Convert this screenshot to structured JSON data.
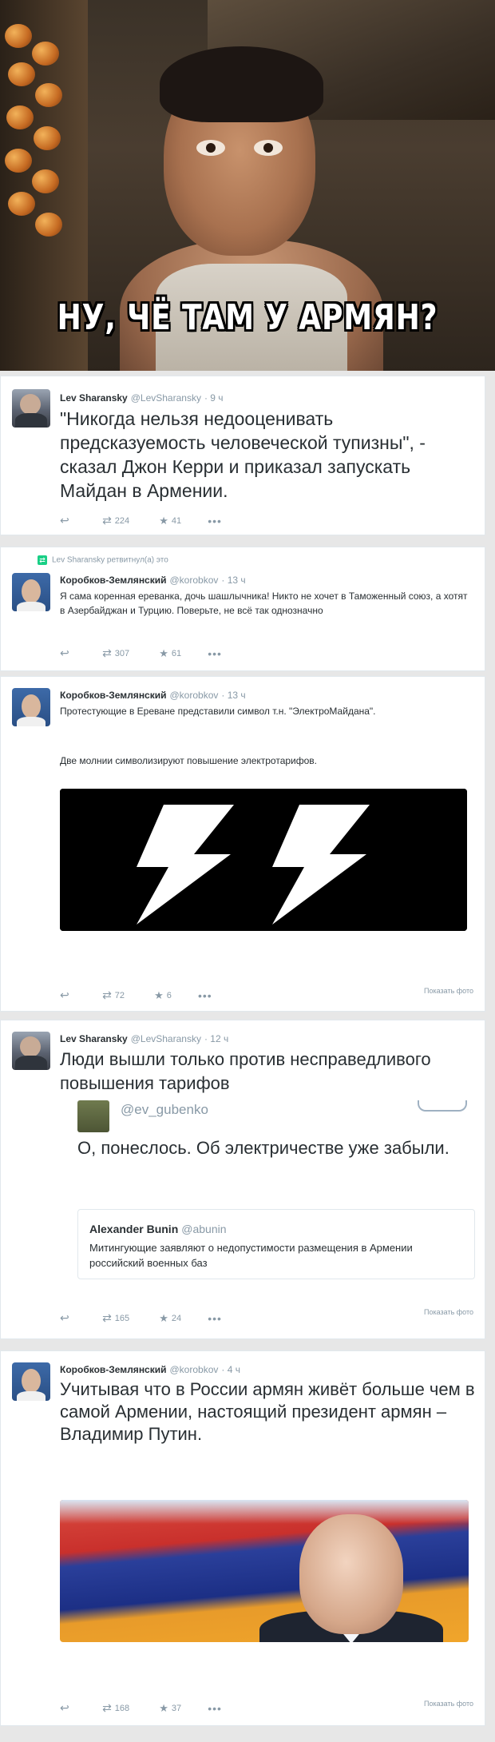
{
  "meme": {
    "caption": "НУ, ЧЁ ТАМ У АРМЯН?"
  },
  "tweets": [
    {
      "name": "Lev Sharansky",
      "handle": "@LevSharansky",
      "time": "· 9 ч",
      "text": "\"Никогда нельзя недооценивать предсказуемость человеческой тупизны\", - сказал Джон Керри и приказал запускать Майдан в Армении.",
      "retweets": "224",
      "favorites": "41"
    },
    {
      "retweeted_by": "Lev Sharansky ретвитнул(а) это",
      "name": "Коробков-Землянский",
      "handle": "@korobkov",
      "time": "· 13 ч",
      "text": "Я сама коренная ереванка, дочь шашлычника! Никто не хочет в Таможенный союз, а хотят в Азербайджан и Турцию. Поверьте, не всё так однозначно",
      "retweets": "307",
      "favorites": "61"
    },
    {
      "name": "Коробков-Землянский",
      "handle": "@korobkov",
      "time": "· 13 ч",
      "text": "Протестующие в Ереване представили символ т.н. \"ЭлектроМайдана\".",
      "text2": "Две молнии символизируют повышение электротарифов.",
      "retweets": "72",
      "favorites": "6",
      "photo_link": "Показать фото"
    },
    {
      "name": "Lev Sharansky",
      "handle": "@LevSharansky",
      "time": "· 12 ч",
      "text": "Люди вышли только против несправедливого повышения тарифов",
      "quote_handle": "@ev_gubenko",
      "quote_text": "О, понеслось. Об электричестве уже забыли.",
      "inner_name": "Alexander Bunin",
      "inner_handle": "@abunin",
      "inner_text": "Митингующие заявляют о недопустимости размещения в Армении российский военных баз",
      "retweets": "165",
      "favorites": "24",
      "photo_link": "Показать фото"
    },
    {
      "name": "Коробков-Землянский",
      "handle": "@korobkov",
      "time": "· 4 ч",
      "text": "Учитывая что в России армян живёт больше чем в самой Армении, настоящий президент армян – Владимир Путин.",
      "retweets": "168",
      "favorites": "37",
      "photo_link": "Показать фото"
    }
  ],
  "icons": {
    "reply": "reply-icon",
    "retweet": "retweet-icon",
    "favorite": "star-icon",
    "more": "more-icon"
  }
}
